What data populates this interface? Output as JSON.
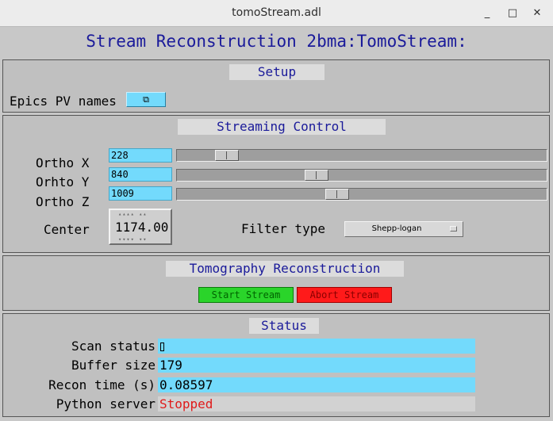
{
  "window": {
    "title": "tomoStream.adl",
    "minimize_glyph": "_",
    "maximize_glyph": "□",
    "close_glyph": "✕"
  },
  "header": {
    "title": "Stream Reconstruction 2bma:TomoStream:"
  },
  "setup": {
    "title": "Setup",
    "epics_label": "Epics PV names",
    "related_display_glyph": "⧉",
    "related_display_icon": "related-display-icon"
  },
  "streaming": {
    "title": "Streaming Control",
    "rows": [
      {
        "label": "Ortho X",
        "value": "228",
        "slider_fraction": 0.11
      },
      {
        "label": "Orhto Y",
        "value": "840",
        "slider_fraction": 0.37
      },
      {
        "label": "Ortho Z",
        "value": "1009",
        "slider_fraction": 0.43
      }
    ],
    "center_label": "Center",
    "center_value": "1174.00",
    "wheel_dots": "▴▴▴▴ ▴▴",
    "wheel_dots_bottom": "▾▾▾▾ ▾▾",
    "filter_label": "Filter type",
    "filter_value": "Shepp-logan"
  },
  "tomo": {
    "title": "Tomography Reconstruction",
    "start_label": "Start Stream",
    "abort_label": "Abort Stream"
  },
  "status": {
    "title": "Status",
    "rows": [
      {
        "label": "Scan status",
        "value": ""
      },
      {
        "label": "Buffer size",
        "value": "179"
      },
      {
        "label": "Recon time (s)",
        "value": "0.08597"
      },
      {
        "label": "Python server",
        "value": "Stopped"
      }
    ]
  },
  "colors": {
    "title_text": "#1a1a9a",
    "field_bg": "#73dafc",
    "start_bg": "#2ad42a",
    "abort_bg": "#ff1a1a",
    "stopped_text": "#e01a1a"
  }
}
